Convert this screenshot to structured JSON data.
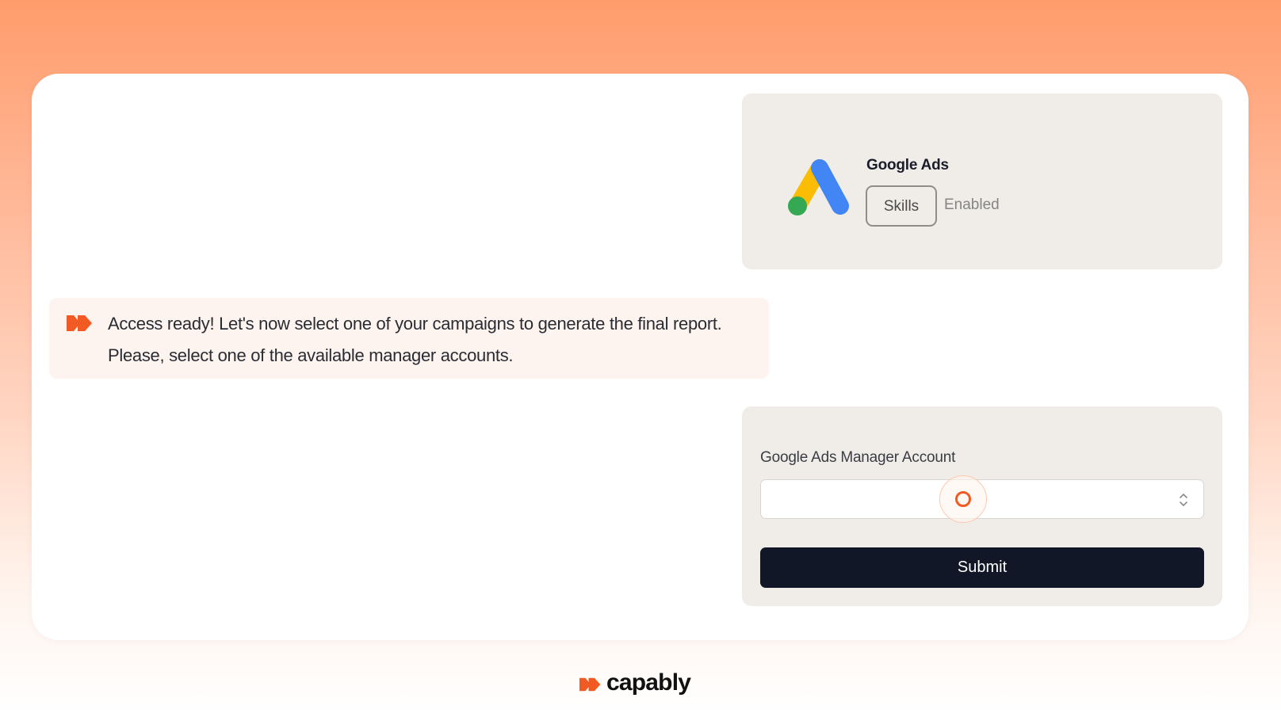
{
  "integration": {
    "title": "Google Ads",
    "badge_label": "Skills",
    "status": "Enabled",
    "icon": "google-ads-logo"
  },
  "message": {
    "icon": "capably-arrow-icon",
    "text": "Access ready! Let's now select one of your campaigns to generate the final report. Please, select one of the available manager accounts."
  },
  "form": {
    "field_label": "Google Ads Manager Account",
    "select_value": "",
    "submit_label": "Submit"
  },
  "brand": {
    "name": "capably",
    "icon": "capably-arrow-icon"
  },
  "colors": {
    "accent": "#f15a22",
    "submit_bg": "#121727",
    "card_bg": "#f0ede9",
    "message_bg": "#fdf3ef"
  }
}
